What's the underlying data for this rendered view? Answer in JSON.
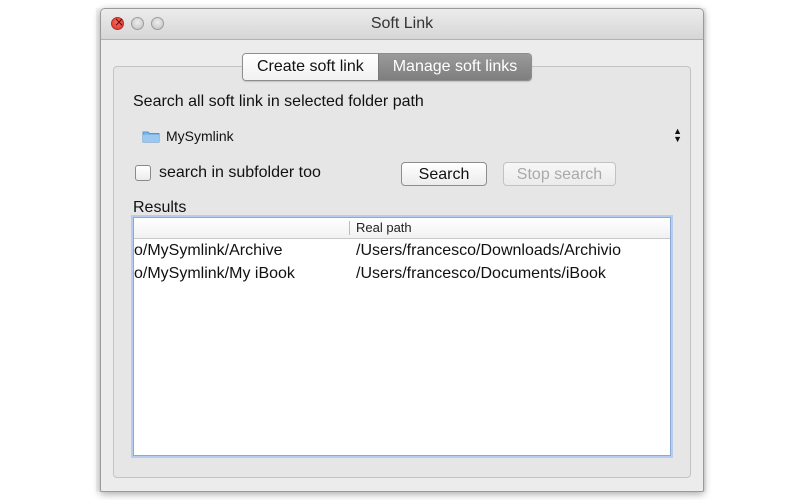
{
  "window": {
    "title": "Soft Link"
  },
  "tabs": [
    {
      "label": "Create soft link",
      "active": false
    },
    {
      "label": "Manage soft links",
      "active": true
    }
  ],
  "search": {
    "prompt": "Search all soft link in selected folder path",
    "folder": {
      "name": "MySymlink",
      "icon": "folder-icon"
    },
    "subfolder_checkbox": {
      "label": "search in subfolder too",
      "checked": false
    },
    "search_button": "Search",
    "stop_button": "Stop search"
  },
  "results": {
    "label": "Results",
    "columns": [
      "",
      "Real path"
    ],
    "rows": [
      {
        "link": "o/MySymlink/Archive",
        "real": "/Users/francesco/Downloads/Archivio"
      },
      {
        "link": "o/MySymlink/My iBook",
        "real": "/Users/francesco/Documents/iBook"
      }
    ]
  },
  "colors": {
    "active_tab": "#8a8a8a",
    "close_button": "#e8453c",
    "focus_ring": "#8aa9d4",
    "folder": "#7fb6e8"
  }
}
